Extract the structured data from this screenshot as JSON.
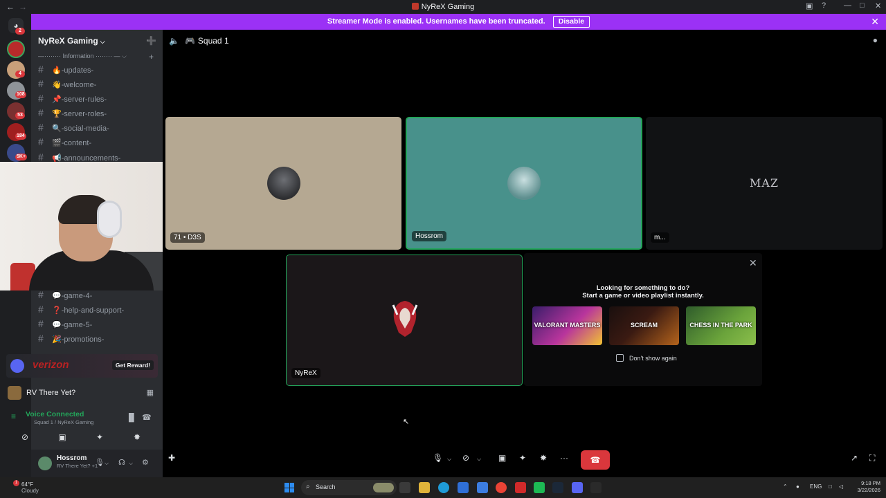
{
  "window": {
    "title": "NyReX Gaming",
    "back_glyph": "←",
    "forward_glyph": "→",
    "inbox_glyph": "▣",
    "help_glyph": "?",
    "minimize_glyph": "—",
    "maximize_glyph": "□",
    "close_glyph": "✕"
  },
  "banner": {
    "text": "Streamer Mode is enabled. Usernames have been truncated.",
    "disable_label": "Disable",
    "close_glyph": "✕",
    "color": "#9b31f5"
  },
  "rail": {
    "home_glyph": "◕",
    "home_badge": "2",
    "badges": [
      "4",
      "108",
      "53",
      "184",
      "5K+"
    ]
  },
  "server": {
    "name": "NyReX Gaming",
    "caret": "⌵",
    "add_user_glyph": "➕"
  },
  "category": {
    "label": "—········ Information ········ — ⌵",
    "plus": "+"
  },
  "channels_top": [
    "-updates-",
    "-welcome-",
    "-server-rules-",
    "-server-roles-",
    "-social-media-",
    "-content-",
    "-announcements-"
  ],
  "channels_bottom": [
    "-game-4-",
    "-help-and-support-",
    "-game-5-",
    "-promotions-"
  ],
  "channel_emojis_top": [
    "🔥",
    "👋",
    "📌",
    "🏆",
    "🔍",
    "🎬",
    "📢"
  ],
  "channel_emojis_bottom": [
    "💬",
    "❓",
    "💬",
    "🎉"
  ],
  "hash_glyph": "#",
  "boost": {
    "brand": "verizon",
    "button": "Get Reward!"
  },
  "activity": {
    "name": "RV There Yet?",
    "icon_glyph": "▦"
  },
  "voice": {
    "status": "Voice Connected",
    "location": "Squad 1 / NyReX Gaming",
    "signal_glyph": "≡",
    "wave_glyph": "▐▌",
    "disconnect_glyph": "☎"
  },
  "voice_buttons": [
    "⊘",
    "▣",
    "✦",
    "✸"
  ],
  "user": {
    "name": "Hossrom",
    "status": "RV There Yet? +1",
    "mic_glyph": "🎙",
    "headset_glyph": "☊",
    "settings_glyph": "⚙",
    "dropdown_glyph": "⌵"
  },
  "call": {
    "channel": "Squad 1",
    "speaker_glyph": "🔈",
    "gamepad_glyph": "🎮",
    "chat_glyph": "●",
    "participants": [
      {
        "label": "71 • D3S"
      },
      {
        "label": "Hossrom"
      },
      {
        "label": "m...",
        "avatar_text": "MAZ"
      },
      {
        "label": "NyReX"
      }
    ]
  },
  "suggestion": {
    "line1": "Looking for something to do?",
    "line2": "Start a game or video playlist instantly.",
    "games": [
      "VALORANT MASTERS",
      "SCREAM",
      "CHESS IN THE PARK"
    ],
    "dont_show": "Don't show again",
    "close_glyph": "✕"
  },
  "controls": {
    "mic": "🎙",
    "camera": "⊘",
    "screen": "▣",
    "activities": "✦",
    "soundboard": "✸",
    "more": "···",
    "end_call": "☎",
    "popout": "↗",
    "fullscreen": "⛶",
    "dropdown": "⌵",
    "invite": "✚"
  },
  "taskbar": {
    "weather_badge": "1",
    "temp": "64°F",
    "condition": "Cloudy",
    "search": "Search",
    "lang": "ENG",
    "time": "9:18 PM",
    "date": "3/22/2026",
    "chevron": "⌃",
    "search_glyph": "⌕"
  }
}
